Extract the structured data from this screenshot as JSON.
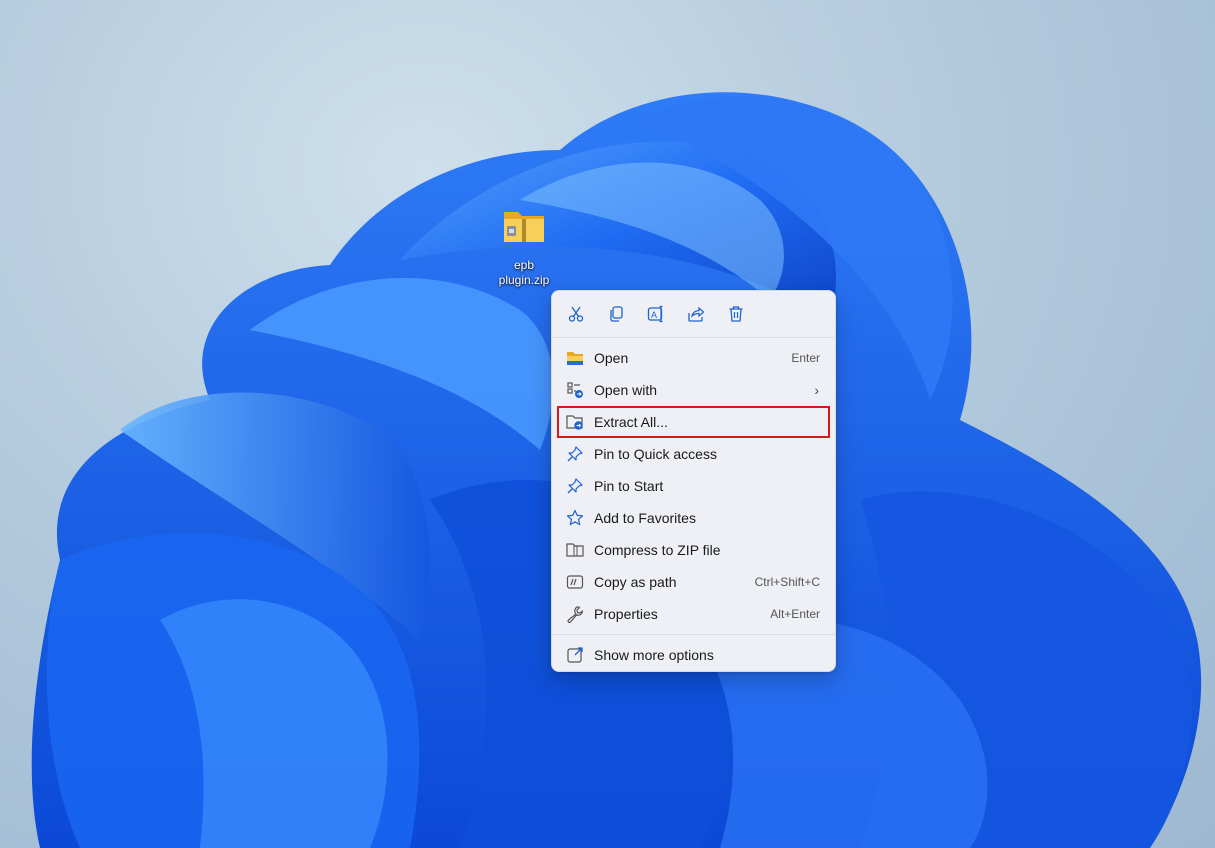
{
  "desktop": {
    "file_icon": "zip-folder-icon",
    "file_label_line1": "epb",
    "file_label_line2": "plugin.zip"
  },
  "menu": {
    "toolbar": [
      {
        "name": "cut-icon",
        "label": "Cut"
      },
      {
        "name": "copy-icon",
        "label": "Copy"
      },
      {
        "name": "rename-icon",
        "label": "Rename"
      },
      {
        "name": "share-icon",
        "label": "Share"
      },
      {
        "name": "delete-icon",
        "label": "Delete"
      }
    ],
    "items": [
      {
        "label": "Open",
        "shortcut": "Enter",
        "icon": "folder-icon"
      },
      {
        "label": "Open with",
        "shortcut": "",
        "icon": "open-with-icon",
        "submenu": "›"
      },
      {
        "label": "Extract All...",
        "shortcut": "",
        "icon": "extract-icon",
        "highlighted": true
      },
      {
        "label": "Pin to Quick access",
        "shortcut": "",
        "icon": "pin-icon"
      },
      {
        "label": "Pin to Start",
        "shortcut": "",
        "icon": "pin-icon"
      },
      {
        "label": "Add to Favorites",
        "shortcut": "",
        "icon": "star-icon"
      },
      {
        "label": "Compress to ZIP file",
        "shortcut": "",
        "icon": "zip-icon"
      },
      {
        "label": "Copy as path",
        "shortcut": "Ctrl+Shift+C",
        "icon": "copy-path-icon"
      },
      {
        "label": "Properties",
        "shortcut": "Alt+Enter",
        "icon": "wrench-icon"
      }
    ],
    "more_options": {
      "label": "Show more options",
      "icon": "more-options-icon"
    }
  },
  "colors": {
    "accent": "#1e62d0",
    "highlight_border": "#d61a1a",
    "folder_yellow": "#f4c542"
  }
}
